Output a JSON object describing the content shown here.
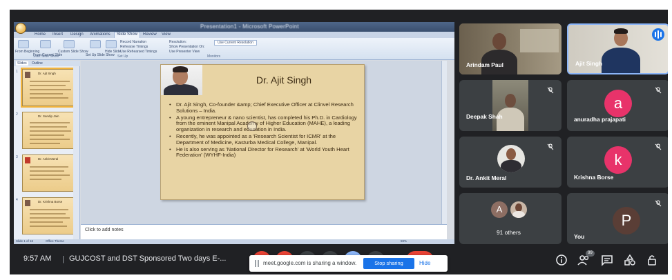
{
  "presentation": {
    "window_title": "Presentation1 - Microsoft PowerPoint",
    "tabs": [
      "Home",
      "Insert",
      "Design",
      "Animations",
      "Slide Show",
      "Review",
      "View"
    ],
    "active_tab": "Slide Show",
    "ribbon": {
      "from_beginning": "From Beginning",
      "from_current": "From Current Slide",
      "custom_show": "Custom Slide Show",
      "setup": "Set Up Slide Show",
      "hide": "Hide Slide",
      "record": "Record Narration",
      "rehearse": "Rehearse Timings",
      "use_timings": "Use Rehearsed Timings",
      "resolution_label": "Resolution:",
      "resolution_value": "Use Current Resolution",
      "show_on": "Show Presentation On:",
      "presenter_view": "Use Presenter View",
      "group_start": "Start Slide Show",
      "group_setup": "Set Up",
      "group_monitors": "Monitors"
    },
    "pane_tabs": [
      "Slides",
      "Outline"
    ],
    "thumbnails": [
      {
        "num": "1",
        "title": "Dr. Ajit Singh"
      },
      {
        "num": "2",
        "title": "Dr. Sandip Jain"
      },
      {
        "num": "3",
        "title": "Dr. Ankit Meral"
      },
      {
        "num": "4",
        "title": "Dr. Krishna Borse"
      }
    ],
    "slide": {
      "title": "Dr. Ajit Singh",
      "bullets": [
        "Dr. Ajit Singh, Co-founder &amp; Chief Executive Officer at Clinvel Research Solutions – India.",
        "A young entrepreneur & nano scientist, has completed his Ph.D. in Cardiology from the eminent Manipal Academy of Higher Education (MAHE), a leading organization in research and education in India.",
        "Recently, he was appointed as a 'Research Scientist for ICMR' at the Department of Medicine, Kasturba Medical College, Manipal.",
        "He is also serving as 'National Director for Research' at 'World Youth Heart Federation' (WYHF-India)"
      ]
    },
    "notes_placeholder": "Click to add notes",
    "status": {
      "slide_count": "Slide 1 of 16",
      "theme": "Office Theme",
      "zoom": "59%"
    }
  },
  "participants": [
    {
      "name": "Arindam Paul",
      "type": "video",
      "muted": false
    },
    {
      "name": "Ajit Singh",
      "type": "video",
      "muted": false,
      "speaking": true
    },
    {
      "name": "Deepak Shah",
      "type": "video",
      "muted": true
    },
    {
      "name": "anuradha prajapati",
      "type": "avatar",
      "initial": "a",
      "color": "#e8336a",
      "muted": true
    },
    {
      "name": "Dr. Ankit Meral",
      "type": "photo",
      "muted": true
    },
    {
      "name": "Krishna Borse",
      "type": "avatar",
      "initial": "k",
      "color": "#e8336a",
      "muted": true
    },
    {
      "name": "91 others",
      "type": "group",
      "initial": "A"
    },
    {
      "name": "You",
      "type": "avatar",
      "initial": "P",
      "color": "#5a3e36",
      "muted": true
    }
  ],
  "bottom_bar": {
    "time": "9:57 AM",
    "separator": "|",
    "meeting_title": "GUJCOST and DST Sponsored Two days E-...",
    "share_text": "meet.google.com is sharing a window.",
    "stop_sharing": "Stop sharing",
    "hide": "Hide",
    "people_badge": "99",
    "colors": {
      "end_call": "#ea4335",
      "accent": "#1a73e8"
    }
  }
}
